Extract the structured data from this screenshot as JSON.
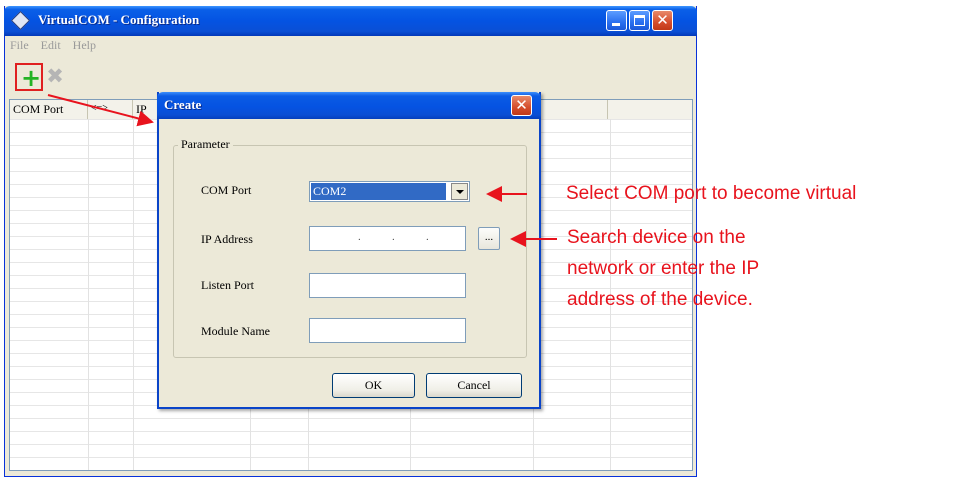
{
  "window": {
    "title": "VirtualCOM - Configuration"
  },
  "menu": [
    {
      "label": "File"
    },
    {
      "label": "Edit"
    },
    {
      "label": "Help"
    }
  ],
  "toolbar": {
    "add_icon": "plus-icon",
    "delete_icon": "x-icon"
  },
  "grid": {
    "columns": [
      "COM Port",
      "<=>",
      "IP"
    ]
  },
  "dialog": {
    "title": "Create",
    "group_label": "Parameter",
    "fields": {
      "com_port_label": "COM Port",
      "com_port_value": "COM2",
      "ip_label": "IP Address",
      "ip_value": ". . .",
      "browse_label": "...",
      "listen_port_label": "Listen Port",
      "listen_port_value": "",
      "module_name_label": "Module Name",
      "module_name_value": ""
    },
    "ok_label": "OK",
    "cancel_label": "Cancel"
  },
  "annotations": {
    "select_com": "Select COM port to become virtual",
    "search_line1": "Search device on the",
    "search_line2": "network or enter the IP",
    "search_line3": "address of the device."
  },
  "colors": {
    "annotation": "#e8131d",
    "titlebar": "#0453e2",
    "selection": "#316ac5"
  }
}
